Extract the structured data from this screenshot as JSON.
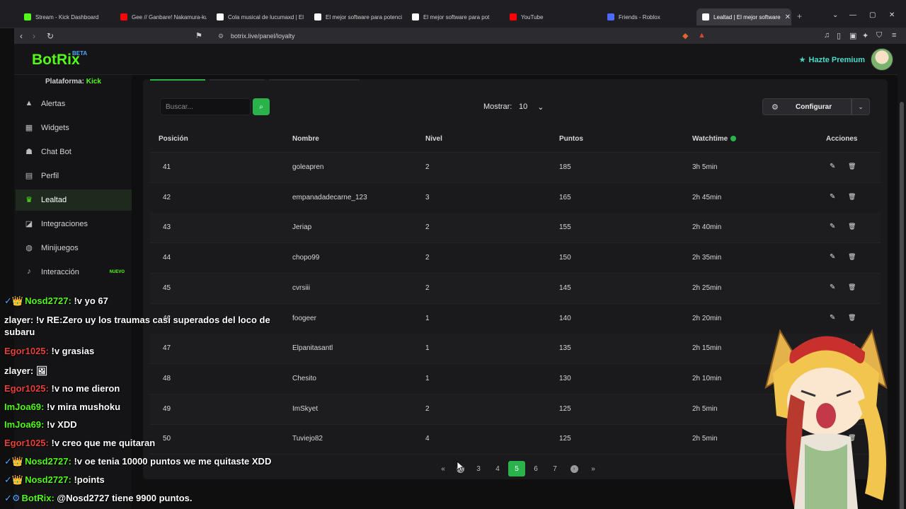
{
  "browser": {
    "tabs": [
      {
        "title": "Stream - Kick Dashboard",
        "color": "#53fc18",
        "active": false
      },
      {
        "title": "Gee // Ganbare! Nakamura-ku",
        "color": "#ff0000",
        "active": false
      },
      {
        "title": "Cola musical de lucumaxd | El",
        "color": "#ffffff",
        "active": false
      },
      {
        "title": "El mejor software para potenci",
        "color": "#ffffff",
        "active": false
      },
      {
        "title": "El mejor software para pot",
        "color": "#ffffff",
        "active": false
      },
      {
        "title": "YouTube",
        "color": "#ff0000",
        "active": false
      },
      {
        "title": "Friends - Roblox",
        "color": "#4f6bff",
        "active": false
      },
      {
        "title": "Lealtad | El mejor software",
        "color": "#ffffff",
        "active": true
      }
    ],
    "url": "botrix.live/panel/loyalty"
  },
  "app": {
    "logo": "BotRix",
    "logo_badge": "BETA",
    "premium": "Hazte Premium",
    "platform_label": "Plataforma:",
    "platform_value": "Kick"
  },
  "sidebar": {
    "items": [
      {
        "label": "Alertas",
        "icon": "warning-icon",
        "glyph": "▲"
      },
      {
        "label": "Widgets",
        "icon": "widgets-icon",
        "glyph": "▦"
      },
      {
        "label": "Chat Bot",
        "icon": "robot-icon",
        "glyph": "☗"
      },
      {
        "label": "Perfil",
        "icon": "id-card-icon",
        "glyph": "▤"
      },
      {
        "label": "Lealtad",
        "icon": "trophy-icon",
        "glyph": "♛"
      },
      {
        "label": "Integraciones",
        "icon": "puzzle-icon",
        "glyph": "◪"
      },
      {
        "label": "Minijuegos",
        "icon": "gamepad-icon",
        "glyph": "◍"
      },
      {
        "label": "Interacción",
        "icon": "music-icon",
        "glyph": "♪",
        "badge": "NUEVO"
      }
    ]
  },
  "toolbar": {
    "search_placeholder": "Buscar...",
    "show_label": "Mostrar:",
    "show_value": "10",
    "config_label": "Configurar"
  },
  "table": {
    "headers": [
      "Posición",
      "Nombre",
      "Nivel",
      "Puntos",
      "Watchtime",
      "Acciones"
    ],
    "rows": [
      {
        "pos": "41",
        "name": "goleapren",
        "level": "2",
        "points": "185",
        "watchtime": "3h 5min"
      },
      {
        "pos": "42",
        "name": "empanadadecarne_123",
        "level": "3",
        "points": "165",
        "watchtime": "2h 45min"
      },
      {
        "pos": "43",
        "name": "Jeriap",
        "level": "2",
        "points": "155",
        "watchtime": "2h 40min"
      },
      {
        "pos": "44",
        "name": "chopo99",
        "level": "2",
        "points": "150",
        "watchtime": "2h 35min"
      },
      {
        "pos": "45",
        "name": "cvrsiii",
        "level": "2",
        "points": "145",
        "watchtime": "2h 25min"
      },
      {
        "pos": "46",
        "name": "foogeer",
        "level": "1",
        "points": "140",
        "watchtime": "2h 20min"
      },
      {
        "pos": "47",
        "name": "Elpanitasantl",
        "level": "1",
        "points": "135",
        "watchtime": "2h 15min"
      },
      {
        "pos": "48",
        "name": "Chesito",
        "level": "1",
        "points": "130",
        "watchtime": "2h 10min"
      },
      {
        "pos": "49",
        "name": "ImSkyet",
        "level": "2",
        "points": "125",
        "watchtime": "2h 5min"
      },
      {
        "pos": "50",
        "name": "Tuviejo82",
        "level": "4",
        "points": "125",
        "watchtime": "2h 5min"
      }
    ]
  },
  "pagination": {
    "first": "«",
    "prev": "‹",
    "pages": [
      "3",
      "4",
      "5",
      "6",
      "7"
    ],
    "current": "5",
    "next": "›",
    "last": "»"
  },
  "chat": [
    {
      "user": "Nosd2727",
      "color": "#53fc18",
      "badges": "✓👑",
      "text": "!v yo 67"
    },
    {
      "user": "zlayer",
      "color": "#ffffff",
      "badges": "",
      "text": "!v RE:Zero uy los traumas casi superados del loco de subaru"
    },
    {
      "user": "Egor1025",
      "color": "#e8423a",
      "badges": "",
      "text": "!v grasias"
    },
    {
      "user": "zlayer",
      "color": "#ffffff",
      "badges": "",
      "text": "🖼"
    },
    {
      "user": "Egor1025",
      "color": "#e8423a",
      "badges": "",
      "text": "!v no me dieron"
    },
    {
      "user": "ImJoa69",
      "color": "#53fc18",
      "badges": "",
      "text": "!v mira mushoku"
    },
    {
      "user": "ImJoa69",
      "color": "#53fc18",
      "badges": "",
      "text": "!v XDD"
    },
    {
      "user": "Egor1025",
      "color": "#e8423a",
      "badges": "",
      "text": "!v creo que me quitaran"
    },
    {
      "user": "Nosd2727",
      "color": "#53fc18",
      "badges": "✓👑",
      "text": "!v oe tenia 10000 puntos we me quitaste XDD"
    },
    {
      "user": "Nosd2727",
      "color": "#53fc18",
      "badges": "✓👑",
      "text": "!points"
    },
    {
      "user": "BotRix",
      "color": "#53fc18",
      "badges": "✓⚙",
      "text": "@Nosd2727 tiene 9900 puntos."
    }
  ]
}
